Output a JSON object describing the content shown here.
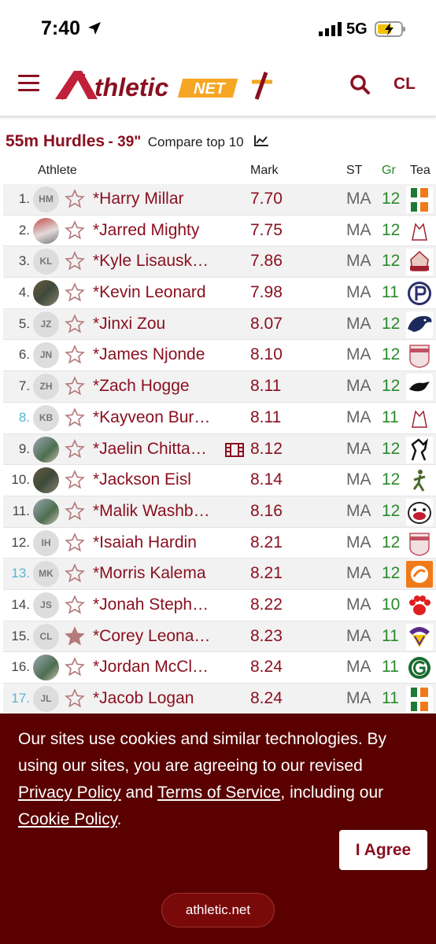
{
  "status": {
    "time": "7:40",
    "network": "5G"
  },
  "header": {
    "logo_text": "AthleticNET",
    "account_label": "CL"
  },
  "event": {
    "name": "55m Hurdles",
    "height": "- 39\"",
    "compare_label": "Compare top 10"
  },
  "columns": {
    "athlete": "Athlete",
    "mark": "Mark",
    "state": "ST",
    "grade": "Gr",
    "team": "Tea"
  },
  "rows": [
    {
      "rank": "1.",
      "initials": "HM",
      "name": "*Harry Millar",
      "mark": "7.70",
      "st": "MA",
      "gr": "12"
    },
    {
      "rank": "2.",
      "initials": "",
      "name": "*Jarred Mighty",
      "mark": "7.75",
      "st": "MA",
      "gr": "12"
    },
    {
      "rank": "3.",
      "initials": "KL",
      "name": "*Kyle Lisausk…",
      "mark": "7.86",
      "st": "MA",
      "gr": "12"
    },
    {
      "rank": "4.",
      "initials": "",
      "name": "*Kevin Leonard",
      "mark": "7.98",
      "st": "MA",
      "gr": "11"
    },
    {
      "rank": "5.",
      "initials": "JZ",
      "name": "*Jinxi Zou",
      "mark": "8.07",
      "st": "MA",
      "gr": "12"
    },
    {
      "rank": "6.",
      "initials": "JN",
      "name": "*James Njonde",
      "mark": "8.10",
      "st": "MA",
      "gr": "12"
    },
    {
      "rank": "7.",
      "initials": "ZH",
      "name": "*Zach Hogge",
      "mark": "8.11",
      "st": "MA",
      "gr": "12"
    },
    {
      "rank": "8.",
      "initials": "KB",
      "name": "*Kayveon Bur…",
      "mark": "8.11",
      "st": "MA",
      "gr": "11"
    },
    {
      "rank": "9.",
      "initials": "",
      "name": "*Jaelin Chitta…",
      "mark": "8.12",
      "st": "MA",
      "gr": "12"
    },
    {
      "rank": "10.",
      "initials": "",
      "name": "*Jackson Eisl",
      "mark": "8.14",
      "st": "MA",
      "gr": "12"
    },
    {
      "rank": "11.",
      "initials": "",
      "name": "*Malik Washb…",
      "mark": "8.16",
      "st": "MA",
      "gr": "12"
    },
    {
      "rank": "12.",
      "initials": "IH",
      "name": "*Isaiah Hardin",
      "mark": "8.21",
      "st": "MA",
      "gr": "12"
    },
    {
      "rank": "13.",
      "initials": "MK",
      "name": "*Morris Kalema",
      "mark": "8.21",
      "st": "MA",
      "gr": "12"
    },
    {
      "rank": "14.",
      "initials": "JS",
      "name": "*Jonah Steph…",
      "mark": "8.22",
      "st": "MA",
      "gr": "10"
    },
    {
      "rank": "15.",
      "initials": "CL",
      "name": "*Corey Leona…",
      "mark": "8.23",
      "st": "MA",
      "gr": "11"
    },
    {
      "rank": "16.",
      "initials": "",
      "name": "*Jordan McCl…",
      "mark": "8.24",
      "st": "MA",
      "gr": "11"
    },
    {
      "rank": "17.",
      "initials": "JL",
      "name": "*Jacob Logan",
      "mark": "8.24",
      "st": "MA",
      "gr": "11"
    }
  ],
  "cookie": {
    "text_1": "Our sites use cookies and similar technologies. By using our sites, you are agreeing to our revised ",
    "privacy_link": "Privacy Policy",
    "text_2": " and ",
    "terms_link": "Terms of Service",
    "text_3": ", including our ",
    "cookie_link": "Cookie Policy",
    "text_4": ".",
    "agree_label": "I Agree"
  },
  "browser": {
    "url": "athletic.net"
  },
  "colors": {
    "brand": "#8a1020",
    "grade": "#2a8a2a",
    "banner": "#5a0000",
    "tie_rank": "#5ab4d6"
  }
}
